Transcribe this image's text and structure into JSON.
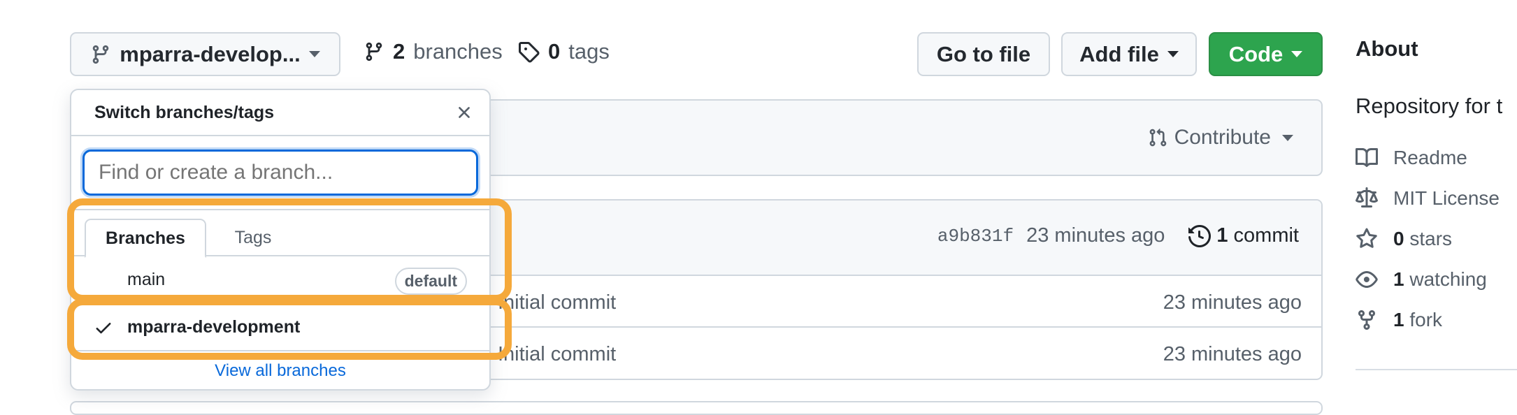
{
  "toolbar": {
    "branch_button_label": "mparra-develop...",
    "branches_count": "2",
    "branches_label": "branches",
    "tags_count": "0",
    "tags_label": "tags",
    "go_to_file": "Go to file",
    "add_file": "Add file",
    "code": "Code"
  },
  "contribute_label": "Contribute",
  "commit_bar": {
    "sha": "a9b831f",
    "time": "23 minutes ago",
    "commit_count": "1",
    "commit_label": "commit"
  },
  "files": [
    {
      "message": "Initial commit",
      "time": "23 minutes ago"
    },
    {
      "message": "Initial commit",
      "time": "23 minutes ago"
    }
  ],
  "sidebar": {
    "about_title": "About",
    "description": "Repository for t",
    "items": [
      {
        "icon": "book-icon",
        "count": "",
        "label": "Readme"
      },
      {
        "icon": "law-icon",
        "count": "",
        "label": "MIT License"
      },
      {
        "icon": "star-icon",
        "count": "0",
        "label": "stars"
      },
      {
        "icon": "eye-icon",
        "count": "1",
        "label": "watching"
      },
      {
        "icon": "fork-icon",
        "count": "1",
        "label": "fork"
      }
    ]
  },
  "dropdown": {
    "title": "Switch branches/tags",
    "search_placeholder": "Find or create a branch...",
    "tabs": [
      "Branches",
      "Tags"
    ],
    "branches": [
      {
        "name": "main",
        "badge": "default",
        "selected": false
      },
      {
        "name": "mparra-development",
        "badge": "",
        "selected": true
      }
    ],
    "view_all": "View all branches"
  },
  "colors": {
    "code_button": "#2da44e",
    "link": "#0969da",
    "highlight": "#f5a93b",
    "focus_border": "#0969da"
  }
}
